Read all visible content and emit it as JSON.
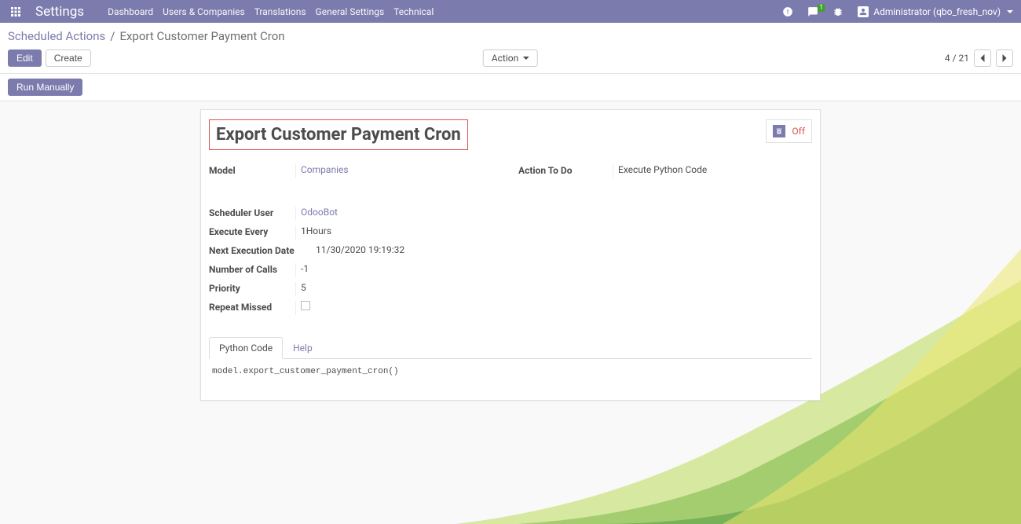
{
  "app_title": "Settings",
  "nav": [
    "Dashboard",
    "Users & Companies",
    "Translations",
    "General Settings",
    "Technical"
  ],
  "messaging_badge": "1",
  "user": "Administrator (qbo_fresh_nov)",
  "breadcrumb": {
    "link": "Scheduled Actions",
    "sep": "/",
    "current": "Export Customer Payment Cron"
  },
  "buttons": {
    "edit": "Edit",
    "create": "Create",
    "action": "Action",
    "run": "Run Manually"
  },
  "pager": "4 / 21",
  "record_title": "Export Customer Payment Cron",
  "toggle_label": "Off",
  "labels": {
    "model": "Model",
    "action_to_do": "Action To Do",
    "scheduler_user": "Scheduler User",
    "execute_every": "Execute Every",
    "next_exec": "Next Execution Date",
    "num_calls": "Number of Calls",
    "priority": "Priority",
    "repeat_missed": "Repeat Missed"
  },
  "values": {
    "model": "Companies",
    "action_to_do": "Execute Python Code",
    "scheduler_user": "OdooBot",
    "execute_every": "1Hours",
    "next_exec": "11/30/2020 19:19:32",
    "num_calls": "-1",
    "priority": "5"
  },
  "tabs": {
    "python": "Python Code",
    "help": "Help"
  },
  "python_code": "model.export_customer_payment_cron()"
}
